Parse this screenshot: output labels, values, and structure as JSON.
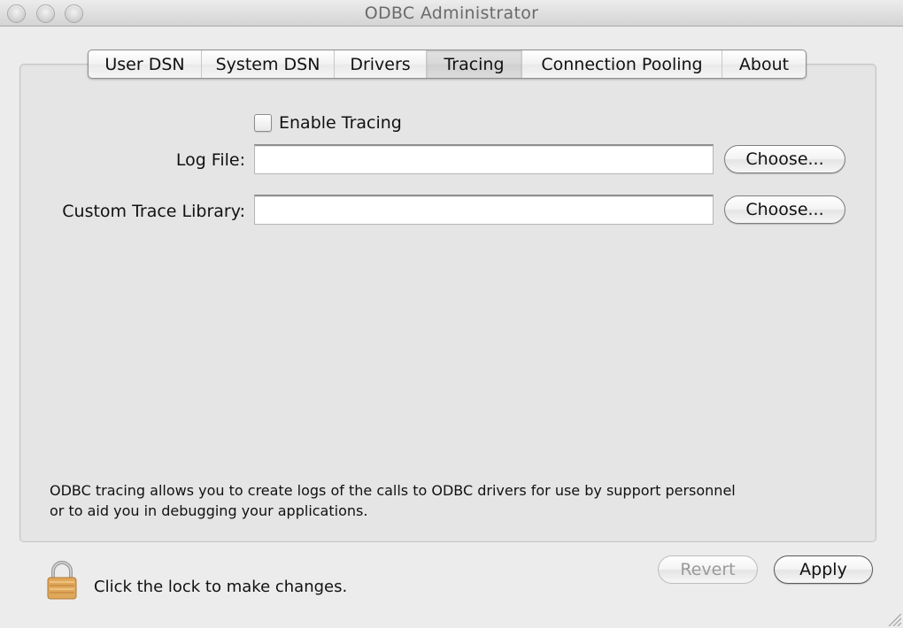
{
  "window": {
    "title": "ODBC Administrator",
    "traffic_lights": [
      "close",
      "minimize",
      "zoom"
    ]
  },
  "tabs": [
    {
      "label": "User DSN",
      "active": false
    },
    {
      "label": "System DSN",
      "active": false
    },
    {
      "label": "Drivers",
      "active": false
    },
    {
      "label": "Tracing",
      "active": true
    },
    {
      "label": "Connection Pooling",
      "active": false
    },
    {
      "label": "About",
      "active": false
    }
  ],
  "tracing": {
    "enable_checkbox": {
      "label": "Enable Tracing",
      "checked": false
    },
    "log_file": {
      "label": "Log File:",
      "value": "",
      "button": "Choose..."
    },
    "trace_library": {
      "label": "Custom Trace Library:",
      "value": "",
      "button": "Choose..."
    },
    "description": "ODBC tracing allows you to create logs of the calls to ODBC drivers for use by support personnel or to aid you in debugging your applications.",
    "description_lines": [
      "ODBC tracing allows you to create logs of the calls to ODBC drivers for use by support personnel",
      "or to aid you in debugging your applications."
    ]
  },
  "footer": {
    "lock_icon": "lock-icon",
    "lock_text": "Click the lock to make changes.",
    "revert_label": "Revert",
    "revert_enabled": false,
    "apply_label": "Apply"
  }
}
